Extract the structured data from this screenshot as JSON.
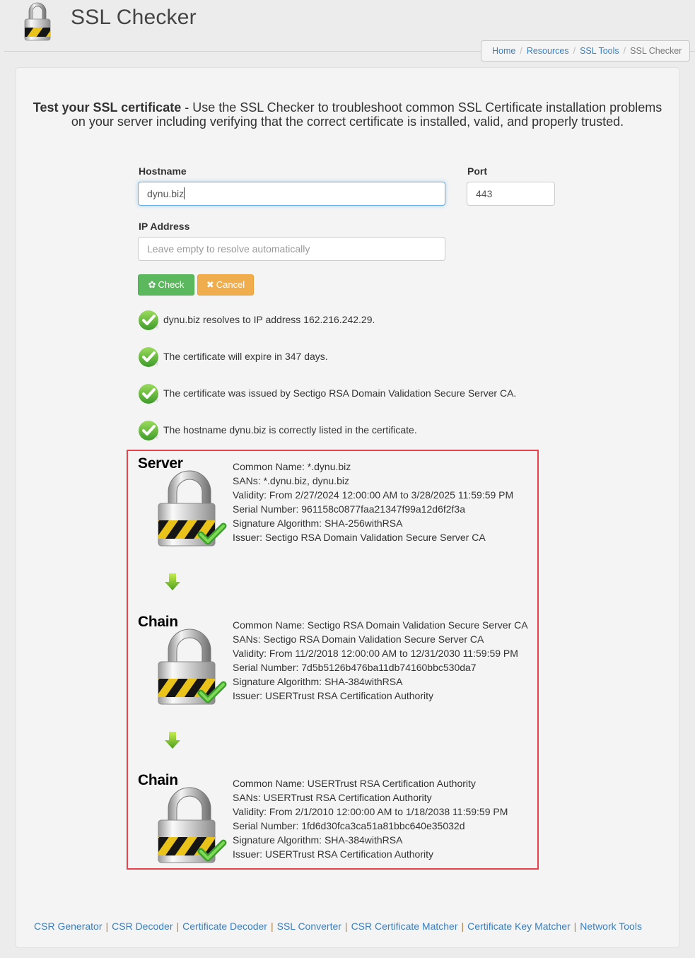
{
  "header": {
    "title": "SSL Checker",
    "logo_icon": "padlock-icon"
  },
  "breadcrumb": [
    {
      "label": "Home",
      "link": true
    },
    {
      "label": "Resources",
      "link": true
    },
    {
      "label": "SSL Tools",
      "link": true
    },
    {
      "label": "SSL Checker",
      "link": false
    }
  ],
  "intro": {
    "bold": "Test your SSL certificate",
    "text": " - Use the SSL Checker to troubleshoot common SSL Certificate installation problems on your server including verifying that the correct certificate is installed, valid, and properly trusted."
  },
  "form": {
    "hostname_label": "Hostname",
    "hostname_value": "dynu.biz",
    "port_label": "Port",
    "port_value": "443",
    "ip_label": "IP Address",
    "ip_placeholder": "Leave empty to resolve automatically",
    "check_label": "Check",
    "check_icon": "gear-icon",
    "cancel_label": "Cancel",
    "cancel_icon": "x-icon"
  },
  "results": [
    "dynu.biz resolves to IP address 162.216.242.29.",
    "The certificate will expire in 347 days.",
    "The certificate was issued by Sectigo RSA Domain Validation Secure Server CA.",
    "The hostname dynu.biz is correctly listed in the certificate."
  ],
  "chain": [
    {
      "kind": "Server",
      "lines": [
        "Common Name: *.dynu.biz",
        "SANs: *.dynu.biz, dynu.biz",
        "Validity: From 2/27/2024 12:00:00 AM to 3/28/2025 11:59:59 PM",
        "Serial Number: 961158c0877faa21347f99a12d6f2f3a",
        "Signature Algorithm: SHA-256withRSA",
        "Issuer: Sectigo RSA Domain Validation Secure Server CA"
      ]
    },
    {
      "kind": "Chain",
      "lines": [
        "Common Name: Sectigo RSA Domain Validation Secure Server CA",
        "SANs: Sectigo RSA Domain Validation Secure Server CA",
        "Validity: From 11/2/2018 12:00:00 AM to 12/31/2030 11:59:59 PM",
        "Serial Number: 7d5b5126b476ba11db74160bbc530da7",
        "Signature Algorithm: SHA-384withRSA",
        "Issuer: USERTrust RSA Certification Authority"
      ]
    },
    {
      "kind": "Chain",
      "lines": [
        "Common Name: USERTrust RSA Certification Authority",
        "SANs: USERTrust RSA Certification Authority",
        "Validity: From 2/1/2010 12:00:00 AM to 1/18/2038 11:59:59 PM",
        "Serial Number: 1fd6d30fca3ca51a81bbc640e35032d",
        "Signature Algorithm: SHA-384withRSA",
        "Issuer: USERTrust RSA Certification Authority"
      ]
    }
  ],
  "footer_links": [
    "CSR Generator",
    "CSR Decoder",
    "Certificate Decoder",
    "SSL Converter",
    "CSR Certificate Matcher",
    "Certificate Key Matcher",
    "Network Tools"
  ],
  "colors": {
    "accent_link": "#3a7fc1",
    "check_button": "#5cb85c",
    "cancel_button": "#f0ad4e",
    "chain_border": "#e8414b",
    "ok_green": "#6cc04a"
  }
}
